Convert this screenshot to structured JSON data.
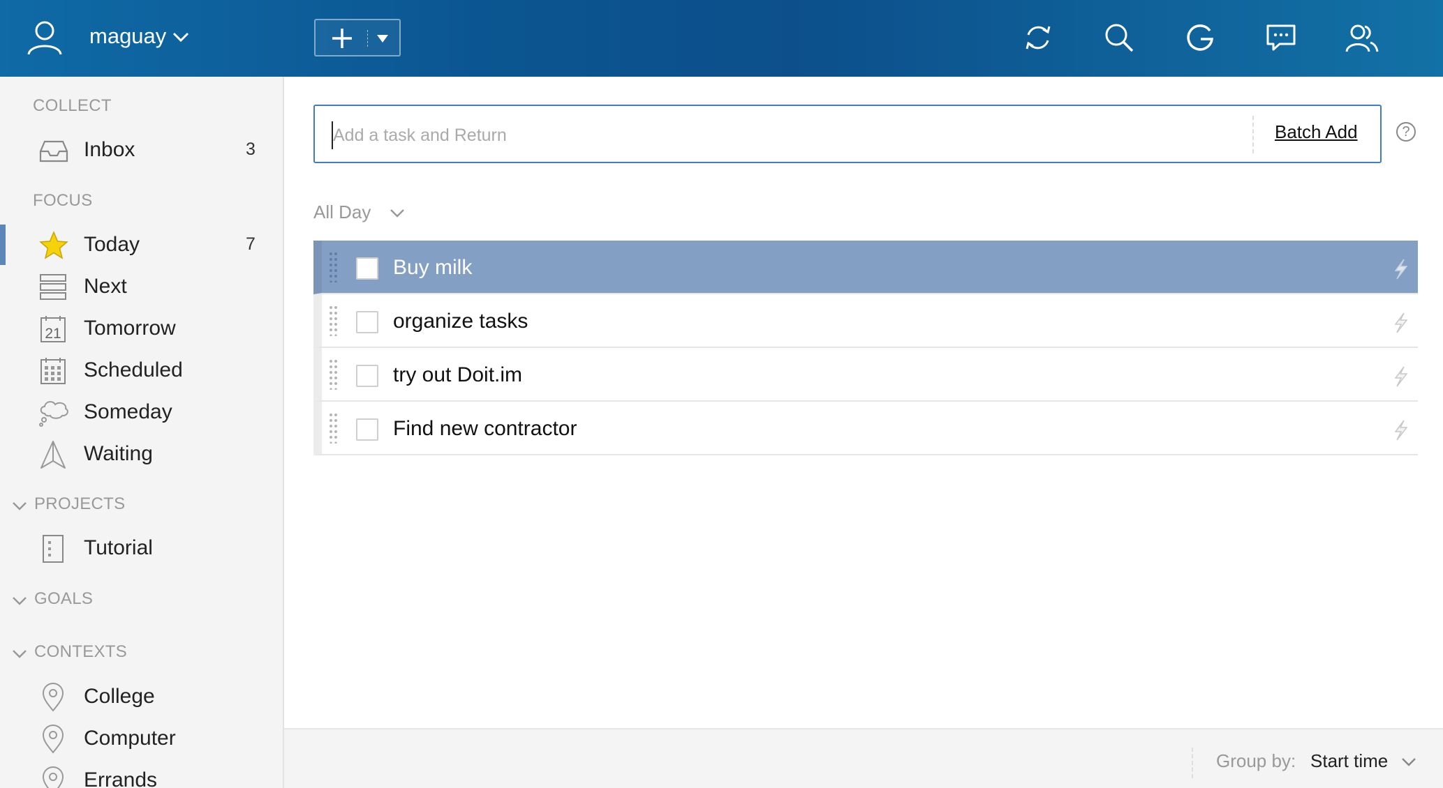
{
  "header": {
    "username": "maguay",
    "icons": [
      "user-icon",
      "chevron-down-icon",
      "plus-icon",
      "caret-down-icon",
      "sync-icon",
      "search-icon",
      "google-icon",
      "messages-icon",
      "contacts-icon"
    ]
  },
  "sidebar": {
    "collect_label": "COLLECT",
    "inbox": {
      "label": "Inbox",
      "count": "3"
    },
    "focus_label": "FOCUS",
    "focus_items": [
      {
        "label": "Today",
        "count": "7"
      },
      {
        "label": "Next"
      },
      {
        "label": "Tomorrow",
        "icon_text": "21"
      },
      {
        "label": "Scheduled"
      },
      {
        "label": "Someday"
      },
      {
        "label": "Waiting"
      }
    ],
    "projects_label": "PROJECTS",
    "projects": [
      {
        "label": "Tutorial"
      }
    ],
    "goals_label": "GOALS",
    "contexts_label": "CONTEXTS",
    "contexts": [
      {
        "label": "College"
      },
      {
        "label": "Computer"
      },
      {
        "label": "Errands"
      }
    ]
  },
  "task_input": {
    "placeholder": "Add a task and Return",
    "batch_add": "Batch Add",
    "help": "?"
  },
  "group": {
    "label": "All Day",
    "tasks": [
      {
        "title": "Buy milk",
        "selected": true
      },
      {
        "title": "organize tasks",
        "selected": false
      },
      {
        "title": "try out Doit.im",
        "selected": false
      },
      {
        "title": "Find new contractor",
        "selected": false
      }
    ]
  },
  "footer": {
    "group_by_label": "Group by:",
    "group_by_value": "Start time"
  },
  "colors": {
    "header_bg": "#0c4f8b",
    "selected_row": "#839fc4",
    "input_border": "#3f7cc4",
    "star": "#f5d20a"
  }
}
